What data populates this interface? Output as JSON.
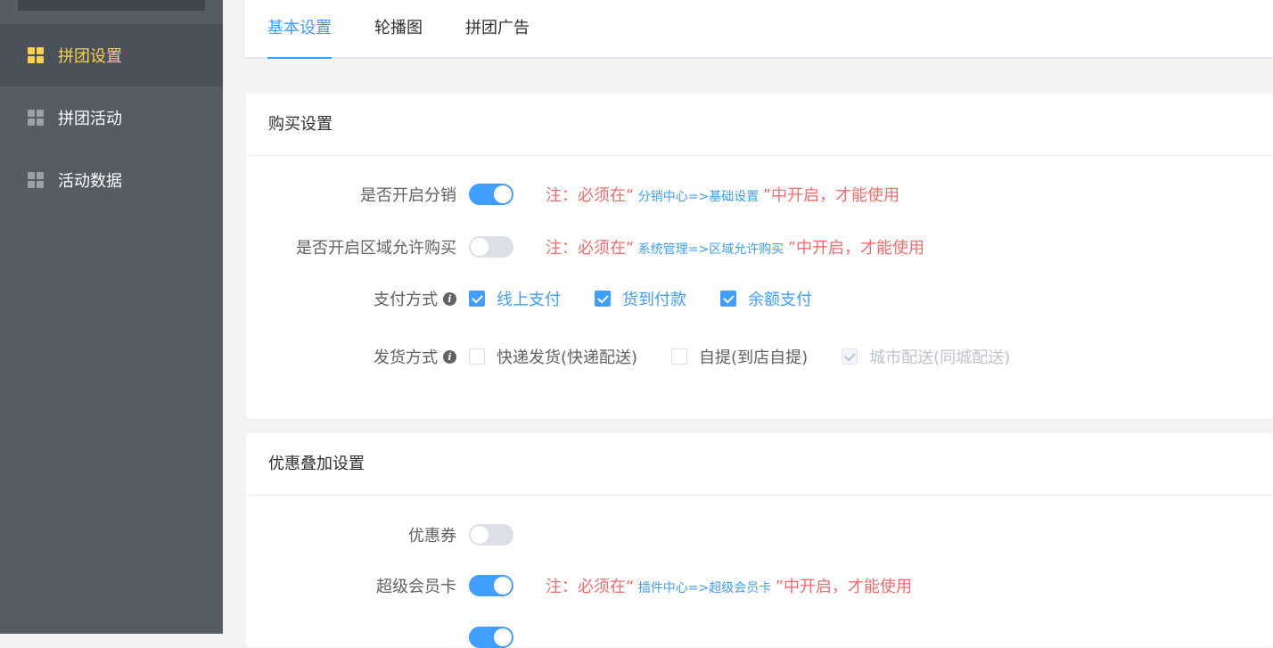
{
  "sidebar": {
    "items": [
      {
        "label": "拼团设置",
        "icon": "grid-icon",
        "active": true
      },
      {
        "label": "拼团活动",
        "icon": "grid-icon",
        "active": false
      },
      {
        "label": "活动数据",
        "icon": "grid-icon",
        "active": false
      }
    ]
  },
  "tabs": [
    {
      "label": "基本设置",
      "active": true
    },
    {
      "label": "轮播图",
      "active": false
    },
    {
      "label": "拼团广告",
      "active": false
    }
  ],
  "purchase": {
    "title": "购买设置",
    "distribution": {
      "label": "是否开启分销",
      "enabled": true,
      "note_prefix": "注：必须在“",
      "note_link": " 分销中心=>基础设置 ",
      "note_suffix": "”中开启，才能使用"
    },
    "region": {
      "label": "是否开启区域允许购买",
      "enabled": false,
      "note_prefix": "注：必须在“",
      "note_link": " 系统管理=>区域允许购买 ",
      "note_suffix": "”中开启，才能使用"
    },
    "payment": {
      "label": "支付方式",
      "options": [
        {
          "label": "线上支付",
          "checked": true
        },
        {
          "label": "货到付款",
          "checked": true
        },
        {
          "label": "余额支付",
          "checked": true
        }
      ]
    },
    "delivery": {
      "label": "发货方式",
      "options": [
        {
          "label": "快递发货(快递配送)",
          "checked": false
        },
        {
          "label": "自提(到店自提)",
          "checked": false
        },
        {
          "label": "城市配送(同城配送)",
          "checked": true,
          "disabled": true
        }
      ]
    }
  },
  "discount": {
    "title": "优惠叠加设置",
    "coupon": {
      "label": "优惠券",
      "enabled": false
    },
    "supercard": {
      "label": "超级会员卡",
      "enabled": true,
      "note_prefix": "注：必须在“",
      "note_link": " 插件中心=>超级会员卡 ",
      "note_suffix": "”中开启，才能使用"
    },
    "member_price": {
      "enabled": true
    }
  },
  "colors": {
    "primary": "#409eff",
    "danger": "#f56c6c",
    "sidebar_bg": "#545c64",
    "sidebar_active": "#ffd04b"
  }
}
